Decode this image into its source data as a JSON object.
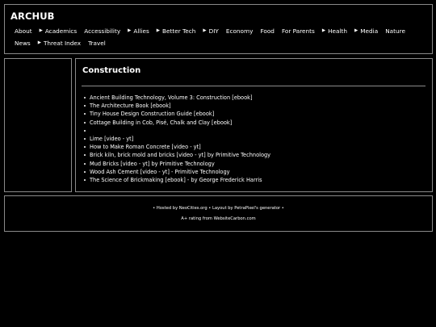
{
  "site_title": "ARCHUB",
  "nav": {
    "row1": [
      {
        "label": "About",
        "arrow": false
      },
      {
        "label": "Academics",
        "arrow": true
      },
      {
        "label": "Accessibility",
        "arrow": false
      },
      {
        "label": "Allies",
        "arrow": true
      },
      {
        "label": "Better Tech",
        "arrow": true
      },
      {
        "label": "DIY",
        "arrow": true
      },
      {
        "label": "Economy",
        "arrow": false
      },
      {
        "label": "Food",
        "arrow": false
      },
      {
        "label": "For Parents",
        "arrow": false
      },
      {
        "label": "Health",
        "arrow": true
      },
      {
        "label": "Media",
        "arrow": true
      },
      {
        "label": "Nature",
        "arrow": false
      }
    ],
    "row2": [
      {
        "label": "News",
        "arrow": false
      },
      {
        "label": "Threat Index",
        "arrow": true
      },
      {
        "label": "Travel",
        "arrow": false
      }
    ],
    "arrow_glyph": "▶"
  },
  "main": {
    "title": "Construction",
    "links": [
      "Ancient Building Technology, Volume 3: Construction [ebook]",
      "The Architecture Book [ebook]",
      "Tiny House Design Construction Guide [ebook]",
      "Cottage Building in Cob, Pisé, Chalk and Clay [ebook]",
      "",
      "Lime [video - yt]",
      "How to Make Roman Concrete [video - yt]",
      "Brick kiln, brick mold and bricks [video - yt] by Primitive Technology",
      "Mud Bricks [video - yt] by Primitive Technology",
      "Wood Ash Cement [video - yt] - Primitive Technology",
      "The Science of Brickmaking [ebook] - by George Frederick Harris"
    ]
  },
  "footer": {
    "line1": "• Hosted by NeoCities.org • Layout by PetraPixel's generator •",
    "line2": "A+ rating from WebsiteCarbon.com"
  }
}
